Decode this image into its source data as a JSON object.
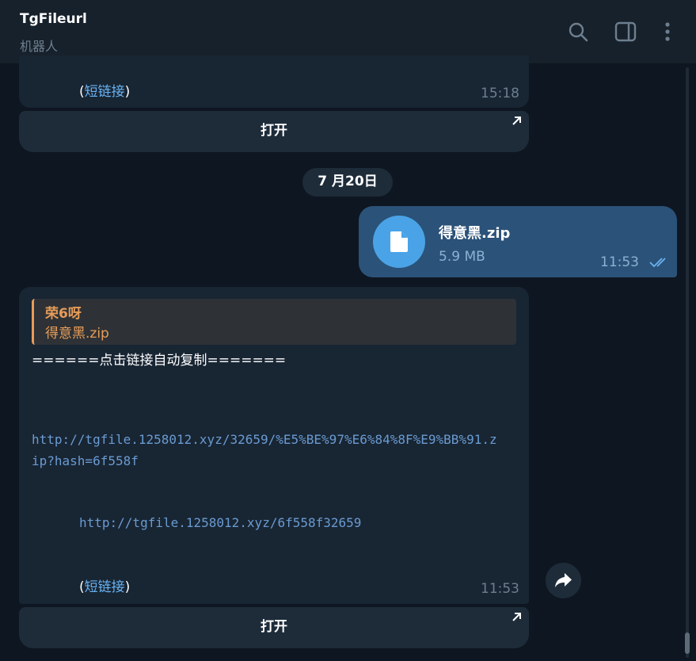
{
  "header": {
    "title": "TgFileurl",
    "subtitle": "机器人",
    "icons": [
      "search-icon",
      "sidebar-toggle-icon",
      "more-vertical-icon"
    ]
  },
  "messages": {
    "top_fragment": {
      "paren_open": "(",
      "short_link": "短链接",
      "paren_close": ")",
      "time": "15:18",
      "button_label": "打开"
    },
    "date_separator": "7 月20日",
    "outgoing_file": {
      "file_name": "得意黑.zip",
      "file_size": "5.9 MB",
      "time": "11:53",
      "status": "read"
    },
    "bot_reply": {
      "reply_to_name": "荣6呀",
      "reply_to_text": "得意黑.zip",
      "header_line": "======点击链接自动复制=======",
      "long_link_line1": "http://tgfile.1258012.xyz/32659/%E5%BE%97%E6%84%8F%E9%BB%91.z",
      "long_link_line2": "ip?hash=6f558f",
      "short_url": "http://tgfile.1258012.xyz/6f558f32659",
      "paren_open": "(",
      "short_link": "短链接",
      "paren_close": ")",
      "time": "11:53",
      "button_label": "打开"
    }
  },
  "colors": {
    "background": "#0e1621",
    "header_bg": "#17212b",
    "incoming_bubble": "#182533",
    "outgoing_bubble": "#2b5278",
    "link": "#6ab3f3",
    "reply_accent": "#e79c58",
    "file_icon": "#4aa3e6"
  }
}
